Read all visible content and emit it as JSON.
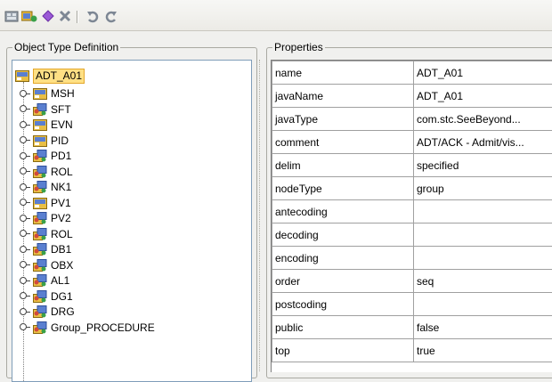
{
  "toolbar": {
    "buttons": [
      {
        "name": "template-icon"
      },
      {
        "name": "add-node-icon"
      },
      {
        "name": "diamond-icon"
      },
      {
        "name": "delete-icon"
      },
      {
        "name": "undo-icon"
      },
      {
        "name": "redo-icon"
      }
    ]
  },
  "left_panel": {
    "title": "Object Type Definition",
    "root": "ADT_A01",
    "items": [
      {
        "label": "MSH",
        "kind": "segment"
      },
      {
        "label": "SFT",
        "kind": "group"
      },
      {
        "label": "EVN",
        "kind": "segment"
      },
      {
        "label": "PID",
        "kind": "segment"
      },
      {
        "label": "PD1",
        "kind": "group"
      },
      {
        "label": "ROL",
        "kind": "group"
      },
      {
        "label": "NK1",
        "kind": "group"
      },
      {
        "label": "PV1",
        "kind": "segment"
      },
      {
        "label": "PV2",
        "kind": "group"
      },
      {
        "label": "ROL",
        "kind": "group"
      },
      {
        "label": "DB1",
        "kind": "group"
      },
      {
        "label": "OBX",
        "kind": "group"
      },
      {
        "label": "AL1",
        "kind": "group"
      },
      {
        "label": "DG1",
        "kind": "group"
      },
      {
        "label": "DRG",
        "kind": "group"
      },
      {
        "label": "Group_PROCEDURE",
        "kind": "group"
      }
    ]
  },
  "right_panel": {
    "title": "Properties",
    "rows": [
      {
        "key": "name",
        "value": "ADT_A01"
      },
      {
        "key": "javaName",
        "value": "ADT_A01"
      },
      {
        "key": "javaType",
        "value": "com.stc.SeeBeyond..."
      },
      {
        "key": "comment",
        "value": "ADT/ACK - Admit/vis..."
      },
      {
        "key": "delim",
        "value": "specified"
      },
      {
        "key": "nodeType",
        "value": "group"
      },
      {
        "key": "antecoding",
        "value": ""
      },
      {
        "key": "decoding",
        "value": ""
      },
      {
        "key": "encoding",
        "value": ""
      },
      {
        "key": "order",
        "value": "seq"
      },
      {
        "key": "postcoding",
        "value": ""
      },
      {
        "key": "public",
        "value": "false"
      },
      {
        "key": "top",
        "value": "true"
      }
    ]
  }
}
